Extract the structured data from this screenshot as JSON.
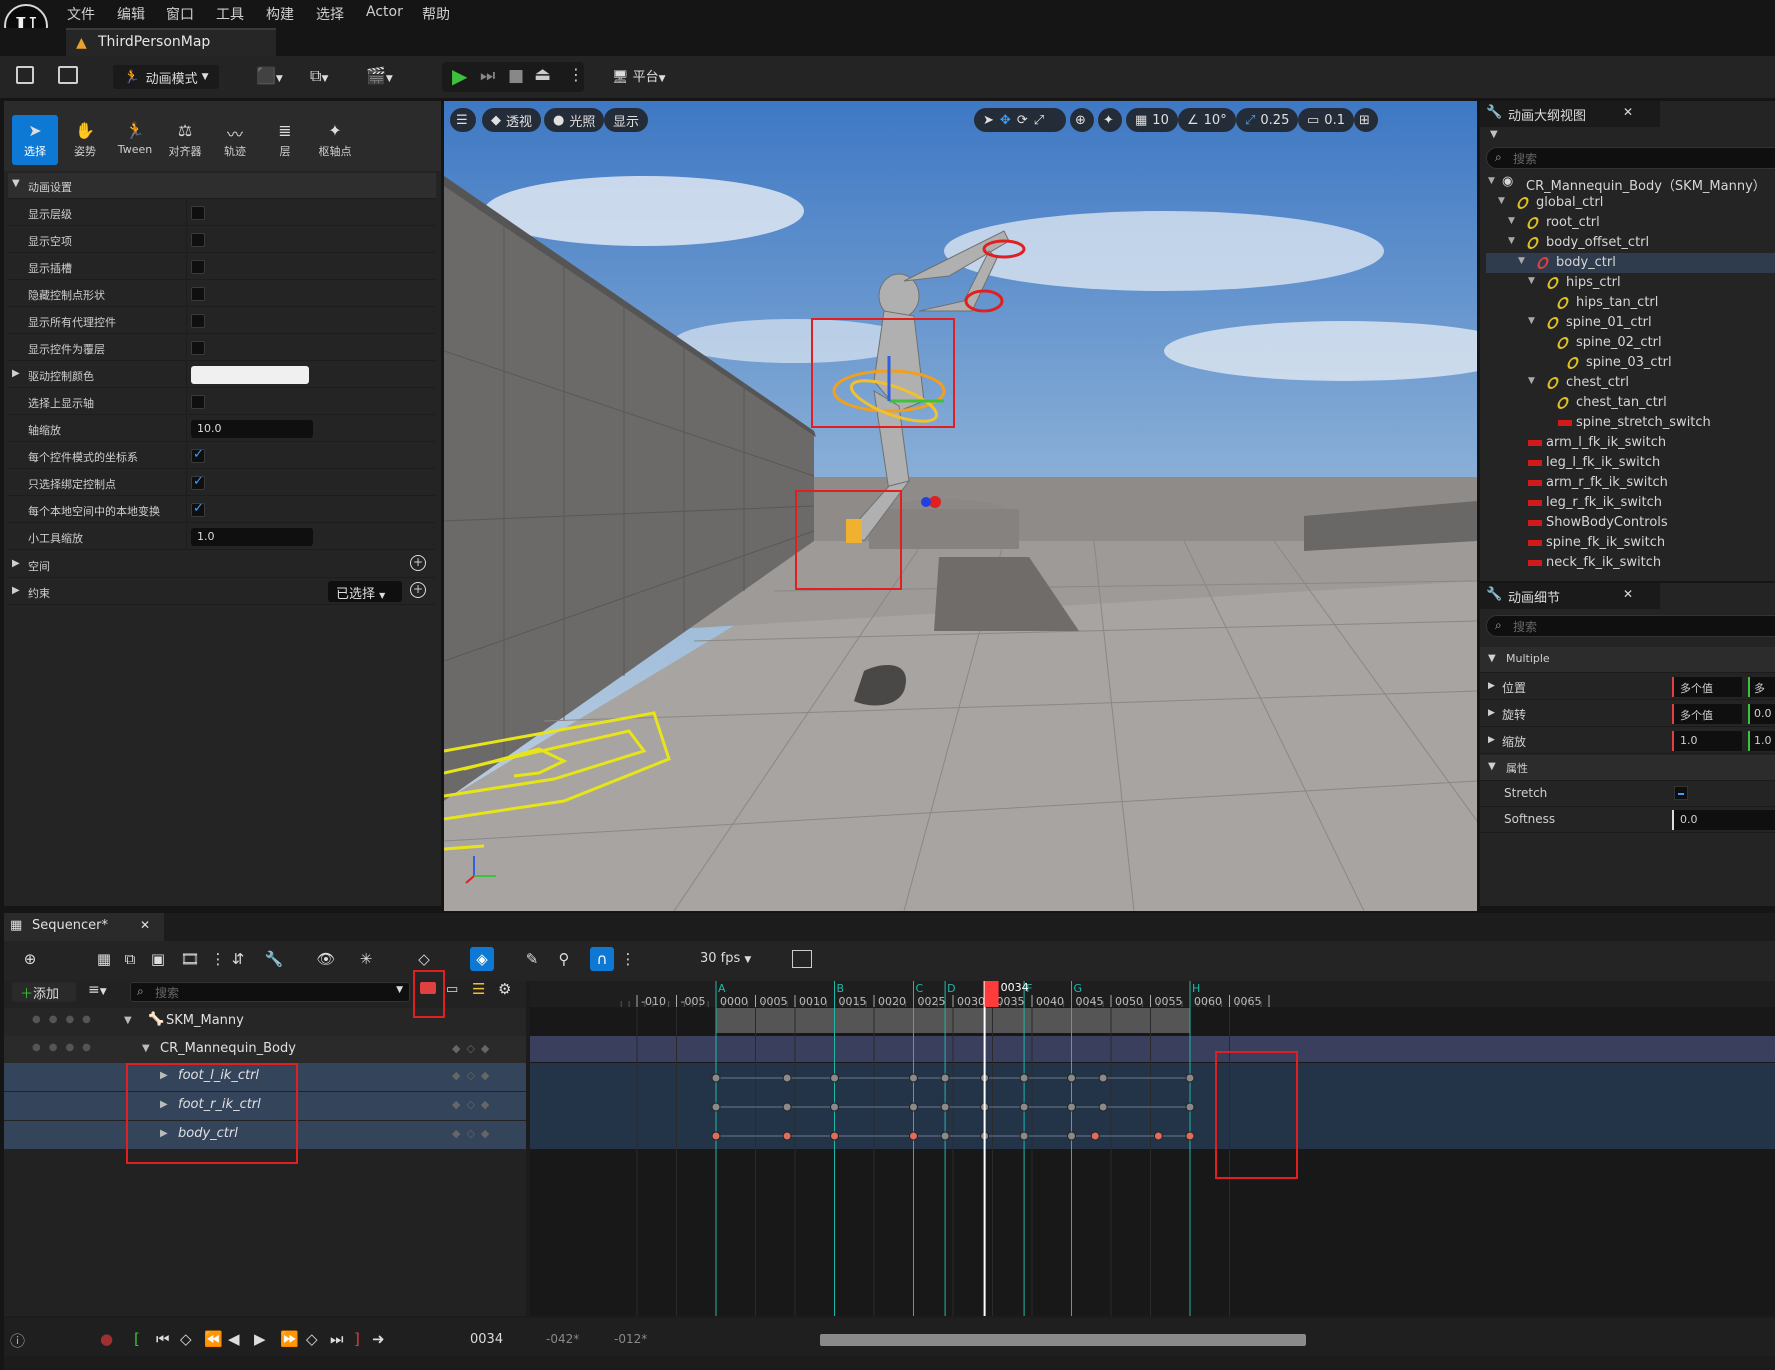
{
  "menu": [
    "文件",
    "编辑",
    "窗口",
    "工具",
    "构建",
    "选择",
    "Actor",
    "帮助"
  ],
  "map_tab": "ThirdPersonMap",
  "toolbar": {
    "mode": "动画模式",
    "platform": "平台"
  },
  "modes": [
    "选择",
    "姿势",
    "Tween",
    "对齐器",
    "轨迹",
    "层",
    "枢轴点"
  ],
  "anim_settings": {
    "section": "动画设置",
    "rows": [
      {
        "label": "显示层级",
        "type": "check",
        "checked": false
      },
      {
        "label": "显示空项",
        "type": "check",
        "checked": false
      },
      {
        "label": "显示插槽",
        "type": "check",
        "checked": false
      },
      {
        "label": "隐藏控制点形状",
        "type": "check",
        "checked": false
      },
      {
        "label": "显示所有代理控件",
        "type": "check",
        "checked": false
      },
      {
        "label": "显示控件为覆层",
        "type": "check",
        "checked": false
      },
      {
        "label": "驱动控制颜色",
        "type": "color"
      },
      {
        "label": "选择上显示轴",
        "type": "check",
        "checked": false
      },
      {
        "label": "轴缩放",
        "type": "value",
        "value": "10.0"
      },
      {
        "label": "每个控件模式的坐标系",
        "type": "check",
        "checked": true
      },
      {
        "label": "只选择绑定控制点",
        "type": "check",
        "checked": true
      },
      {
        "label": "每个本地空间中的本地变换",
        "type": "check",
        "checked": true
      },
      {
        "label": "小工具缩放",
        "type": "value",
        "value": "1.0"
      }
    ],
    "space": "空间",
    "constraint": "约束",
    "constraint_dropdown": "已选择"
  },
  "viewport": {
    "perspective": "透视",
    "lighting": "光照",
    "show": "显示",
    "grid": "10",
    "angle": "10°",
    "scale": "0.25",
    "camera_speed": "0.1"
  },
  "outliner": {
    "title": "动画大纲视图",
    "search": "搜索",
    "items": [
      {
        "label": "CR_Mannequin_Body（SKM_Manny）",
        "indent": 0,
        "icon": "eye"
      },
      {
        "label": "global_ctrl",
        "indent": 1,
        "icon": "bone"
      },
      {
        "label": "root_ctrl",
        "indent": 2,
        "icon": "bone"
      },
      {
        "label": "body_offset_ctrl",
        "indent": 2,
        "icon": "bone"
      },
      {
        "label": "body_ctrl",
        "indent": 3,
        "icon": "bone-red",
        "selected": true
      },
      {
        "label": "hips_ctrl",
        "indent": 4,
        "icon": "bone"
      },
      {
        "label": "hips_tan_ctrl",
        "indent": 5,
        "icon": "bone"
      },
      {
        "label": "spine_01_ctrl",
        "indent": 4,
        "icon": "bone"
      },
      {
        "label": "spine_02_ctrl",
        "indent": 5,
        "icon": "bone"
      },
      {
        "label": "spine_03_ctrl",
        "indent": 6,
        "icon": "bone"
      },
      {
        "label": "chest_ctrl",
        "indent": 4,
        "icon": "bone"
      },
      {
        "label": "chest_tan_ctrl",
        "indent": 5,
        "icon": "bone"
      },
      {
        "label": "spine_stretch_switch",
        "indent": 5,
        "icon": "switch"
      },
      {
        "label": "arm_l_fk_ik_switch",
        "indent": 2,
        "icon": "switch"
      },
      {
        "label": "leg_l_fk_ik_switch",
        "indent": 2,
        "icon": "switch"
      },
      {
        "label": "arm_r_fk_ik_switch",
        "indent": 2,
        "icon": "switch"
      },
      {
        "label": "leg_r_fk_ik_switch",
        "indent": 2,
        "icon": "switch"
      },
      {
        "label": "ShowBodyControls",
        "indent": 2,
        "icon": "switch"
      },
      {
        "label": "spine_fk_ik_switch",
        "indent": 2,
        "icon": "switch"
      },
      {
        "label": "neck_fk_ik_switch",
        "indent": 2,
        "icon": "switch"
      }
    ]
  },
  "details": {
    "title": "动画细节",
    "search": "搜索",
    "group": "Multiple",
    "rows": [
      {
        "label": "位置",
        "value": "多个值",
        "value2": "多"
      },
      {
        "label": "旋转",
        "value": "多个值",
        "value2": "0.0"
      },
      {
        "label": "缩放",
        "value": "1.0",
        "value2": "1.0"
      }
    ],
    "attributes": "属性",
    "stretch": "Stretch",
    "softness": "Softness",
    "softness_value": "0.0"
  },
  "sequencer": {
    "tab": "Sequencer*",
    "fps": "30 fps",
    "add": "添加",
    "search": "搜索",
    "tracks": [
      {
        "label": "SKM_Manny",
        "level": 0
      },
      {
        "label": "CR_Mannequin_Body",
        "level": 1
      },
      {
        "label": "foot_l_ik_ctrl",
        "level": 2
      },
      {
        "label": "foot_r_ik_ctrl",
        "level": 2
      },
      {
        "label": "body_ctrl",
        "level": 2
      }
    ],
    "ruler": [
      {
        "label": "-010",
        "frame": -10
      },
      {
        "label": "-005",
        "frame": -5
      },
      {
        "label": "0000",
        "frame": 0
      },
      {
        "label": "0005",
        "frame": 5
      },
      {
        "label": "0010",
        "frame": 10
      },
      {
        "label": "0015",
        "frame": 15
      },
      {
        "label": "0020",
        "frame": 20
      },
      {
        "label": "0025",
        "frame": 25
      },
      {
        "label": "0030",
        "frame": 30
      },
      {
        "label": "0035",
        "frame": 35
      },
      {
        "label": "0040",
        "frame": 40
      },
      {
        "label": "0045",
        "frame": 45
      },
      {
        "label": "0050",
        "frame": 50
      },
      {
        "label": "0055",
        "frame": 55
      },
      {
        "label": "0060",
        "frame": 60
      },
      {
        "label": "0065",
        "frame": 65
      }
    ],
    "markers": [
      {
        "label": "A",
        "frame": 0
      },
      {
        "label": "B",
        "frame": 15
      },
      {
        "label": "C",
        "frame": 25
      },
      {
        "label": "D",
        "frame": 29
      },
      {
        "label": "F",
        "frame": 39
      },
      {
        "label": "G",
        "frame": 45
      },
      {
        "label": "H",
        "frame": 60
      }
    ],
    "current_frame": "0034",
    "playhead_frame": 34,
    "keys": {
      "foot_l_ik_ctrl": [
        0,
        9,
        15,
        25,
        29,
        34,
        39,
        45,
        49,
        60
      ],
      "foot_r_ik_ctrl": [
        0,
        9,
        15,
        25,
        29,
        34,
        39,
        45,
        49,
        60
      ],
      "body_ctrl": [
        0,
        9,
        15,
        25,
        29,
        34,
        39,
        45,
        48,
        56,
        60
      ]
    },
    "body_ctrl_orange_keys": [
      0,
      9,
      15,
      25,
      48,
      56,
      60
    ],
    "bottom_frame": "0034",
    "range_start": "-042*",
    "range_end": "-012*"
  },
  "colors": {
    "accent": "#0e79d4",
    "key_orange": "#e06c5a",
    "marker": "#1fb8a8",
    "playhead": "#ff3b3b",
    "red_box": "#e02020"
  }
}
